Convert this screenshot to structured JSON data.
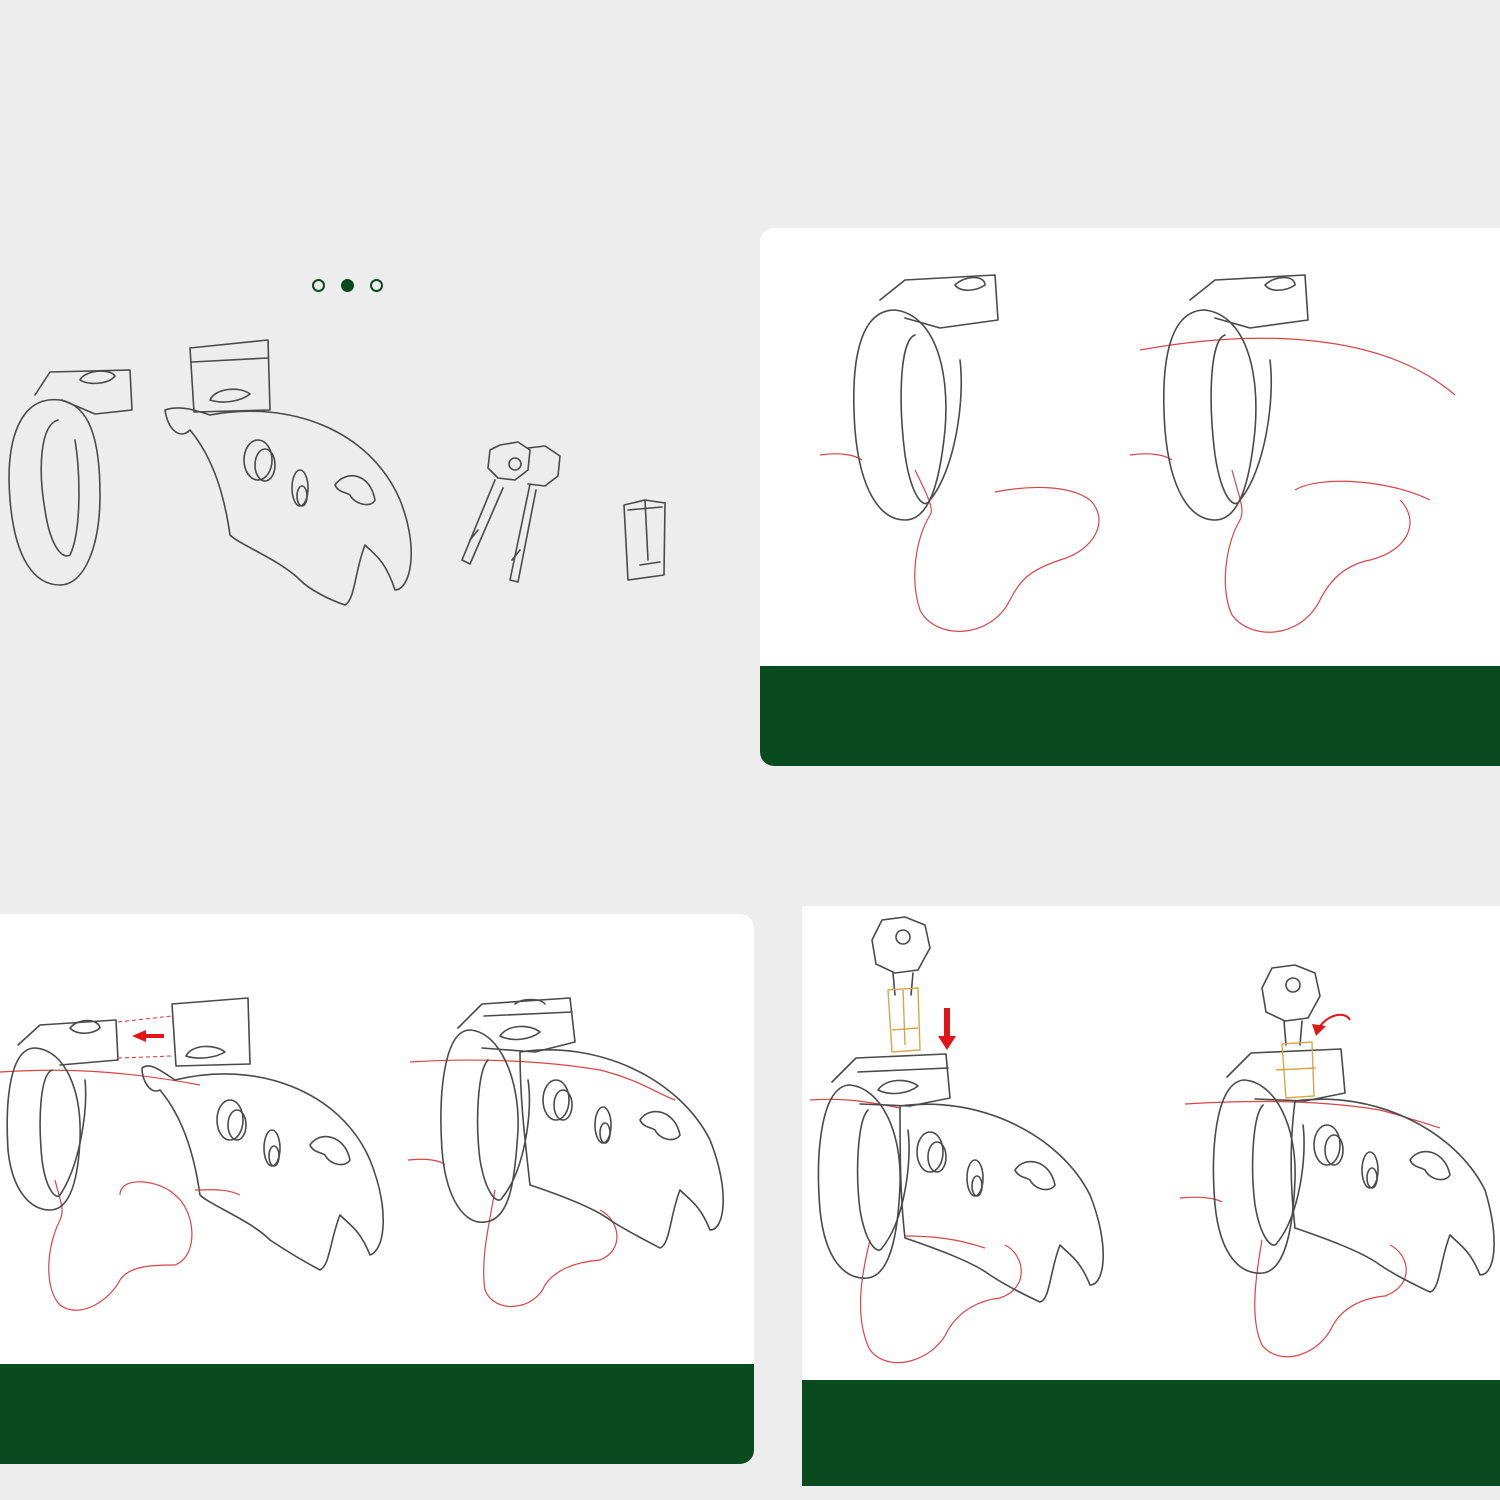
{
  "colors": {
    "background": "#ededed",
    "card": "#ffffff",
    "band": "#0a4a1f",
    "outline": "#4a4a4a",
    "body_outline": "#d94545",
    "arrow": "#e01515",
    "lock_cylinder": "#d4a84a"
  },
  "pager": {
    "count": 3,
    "active_index": 1
  },
  "parts": [
    "base-ring",
    "cage",
    "keys",
    "lock-cylinder"
  ],
  "steps": [
    {
      "panel": "top-right",
      "illustrations": [
        "ring-on-body",
        "ring-fitted-with-body"
      ]
    },
    {
      "panel": "bottom-left",
      "illustrations": [
        "slide-cage-onto-ring",
        "cage-attached"
      ]
    },
    {
      "panel": "bottom-right",
      "illustrations": [
        "insert-lock-with-key",
        "turn-key-to-lock"
      ]
    }
  ]
}
